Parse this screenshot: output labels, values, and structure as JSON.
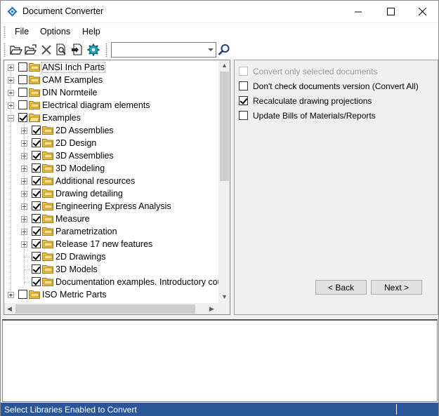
{
  "window": {
    "title": "Document Converter"
  },
  "menu": [
    "File",
    "Options",
    "Help"
  ],
  "toolbar": {
    "icons": [
      "open-folder-icon",
      "open-folder-arrow-icon",
      "delete-icon",
      "preview-icon",
      "export-icon",
      "settings-gear-icon"
    ],
    "combo_value": "",
    "search_icon": "magnifier-icon"
  },
  "tree": {
    "items": [
      {
        "label": "ANSI Inch Parts",
        "checked": false,
        "level": 0
      },
      {
        "label": "CAM Examples",
        "checked": false,
        "level": 0
      },
      {
        "label": "DIN Normteile",
        "checked": false,
        "level": 0
      },
      {
        "label": "Electrical diagram elements",
        "checked": false,
        "level": 0
      },
      {
        "label": "Examples",
        "checked": true,
        "level": 0,
        "expanded": true
      },
      {
        "label": "2D Assemblies",
        "checked": true,
        "level": 1
      },
      {
        "label": "2D Design",
        "checked": true,
        "level": 1
      },
      {
        "label": "3D Assemblies",
        "checked": true,
        "level": 1
      },
      {
        "label": "3D Modeling",
        "checked": true,
        "level": 1
      },
      {
        "label": "Additional resources",
        "checked": true,
        "level": 1
      },
      {
        "label": "Drawing detailing",
        "checked": true,
        "level": 1
      },
      {
        "label": "Engineering Express Analysis",
        "checked": true,
        "level": 1
      },
      {
        "label": "Measure",
        "checked": true,
        "level": 1
      },
      {
        "label": "Parametrization",
        "checked": true,
        "level": 1
      },
      {
        "label": "Release 17 new features",
        "checked": true,
        "level": 1
      },
      {
        "label": "2D Drawings",
        "checked": true,
        "level": 1,
        "leaf": true
      },
      {
        "label": "3D Models",
        "checked": true,
        "level": 1,
        "leaf": true
      },
      {
        "label": "Documentation examples. Introductory cou",
        "checked": true,
        "level": 1,
        "leaf": true
      },
      {
        "label": "ISO Metric Parts",
        "checked": false,
        "level": 0
      }
    ]
  },
  "options": {
    "items": [
      {
        "label": "Convert only selected documents",
        "checked": false,
        "disabled": true
      },
      {
        "label": "Don't check documents version (Convert All)",
        "checked": false,
        "disabled": false
      },
      {
        "label": "Recalculate drawing projections",
        "checked": true,
        "disabled": false
      },
      {
        "label": "Update Bills of Materials/Reports",
        "checked": false,
        "disabled": false
      }
    ],
    "back_label": "< Back",
    "next_label": "Next >"
  },
  "status": {
    "text": "Select Libraries Enabled to Convert"
  },
  "colors": {
    "status_bar": "#2a5699",
    "folder": "#f5c542"
  }
}
